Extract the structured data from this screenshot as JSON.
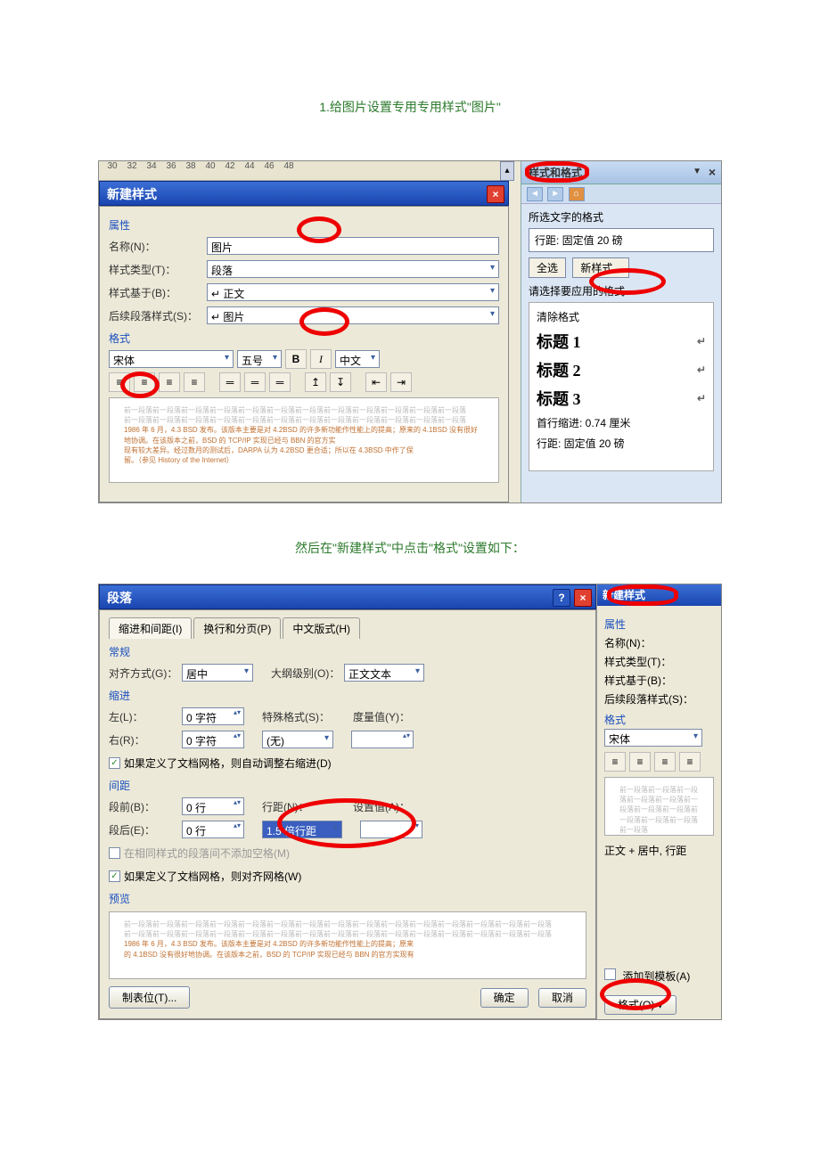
{
  "caption1": "1.给图片设置专用专用样式\"图片\"",
  "caption2": "然后在\"新建样式\"中点击\"格式\"设置如下：",
  "ruler": [
    "30",
    "32",
    "34",
    "36",
    "38",
    "40",
    "42",
    "44",
    "46",
    "48"
  ],
  "dlg1": {
    "title": "新建样式",
    "section_props": "属性",
    "name_lbl": "名称(N)：",
    "name_val": "图片",
    "type_lbl": "样式类型(T)：",
    "type_val": "段落",
    "based_lbl": "样式基于(B)：",
    "based_val": "↵ 正文",
    "follow_lbl": "后续段落样式(S)：",
    "follow_val": "↵ 图片",
    "section_format": "格式",
    "font": "宋体",
    "size": "五号",
    "bold": "B",
    "italic": "I",
    "lang": "中文",
    "preview_grey": "前一段落前一段落前一段落前一段落前一段落前一段落前一段落前一段落前一段落前一段落前一段落前一段落",
    "preview_orange1": "1986 年 6 月，4.3 BSD 发布。该版本主要是对 4.2BSD 的许多新功能作性能上的提高；原来的 4.1BSD 没有很好地协调。在该版本之前，BSD 的 TCP/IP 实现已经与 BBN 的官方实",
    "preview_orange2": "现有较大差异。经过数月的测试后，DARPA 认为 4.2BSD 更合适；所以在 4.3BSD 中作了保",
    "preview_orange3": "留。（参见 History of the Internet）"
  },
  "pane": {
    "title": "样式和格式",
    "selected_lbl": "所选文字的格式",
    "selected_val": "行距: 固定值 20 磅",
    "select_all": "全选",
    "new_style": "新样式...",
    "choose_lbl": "请选择要应用的格式",
    "clear": "清除格式",
    "h1": "标题 1",
    "h2": "标题 2",
    "h3": "标题 3",
    "indent": "首行缩进: 0.74 厘米",
    "line2": "行距: 固定值 20 磅"
  },
  "dlg2": {
    "title": "段落",
    "tab1": "缩进和间距(I)",
    "tab2": "换行和分页(P)",
    "tab3": "中文版式(H)",
    "section_general": "常规",
    "align_lbl": "对齐方式(G)：",
    "align_val": "居中",
    "outline_lbl": "大纲级别(O)：",
    "outline_val": "正文文本",
    "section_indent": "缩进",
    "left_lbl": "左(L)：",
    "left_val": "0 字符",
    "right_lbl": "右(R)：",
    "right_val": "0 字符",
    "special_lbl": "特殊格式(S)：",
    "special_val": "(无)",
    "measure_lbl": "度量值(Y)：",
    "chk1": "如果定义了文档网格，则自动调整右缩进(D)",
    "section_spacing": "间距",
    "before_lbl": "段前(B)：",
    "before_val": "0 行",
    "after_lbl": "段后(E)：",
    "after_val": "0 行",
    "linesp_lbl": "行距(N)：",
    "linesp_val": "1.5 倍行距",
    "setval_lbl": "设置值(A)：",
    "chk2_grey": "在相同样式的段落间不添加空格(M)",
    "chk3": "如果定义了文档网格，则对齐网格(W)",
    "section_preview": "预览",
    "preview_grey": "前一段落前一段落前一段落前一段落前一段落前一段落前一段落前一段落前一段落前一段落前一段落前一段落前一段落前一段落前一段落",
    "preview_orange1": "1986 年 6 月，4.3 BSD 发布。该版本主要是对 4.2BSD 的许多新功能作性能上的提高；原来",
    "preview_orange2": "的 4.1BSD 没有很好地协调。在该版本之前，BSD 的 TCP/IP 实现已经与 BBN 的官方实现有",
    "tabs_btn": "制表位(T)...",
    "ok": "确定",
    "cancel": "取消"
  },
  "frag": {
    "title": "新建样式",
    "attrs": "属性",
    "name": "名称(N)：",
    "type": "样式类型(T)：",
    "based": "样式基于(B)：",
    "follow": "后续段落样式(S)：",
    "fmt": "格式",
    "font": "宋体",
    "summary": "正文 + 居中, 行距",
    "add_tpl": "添加到模板(A)",
    "format_btn": "格式(O) ▾"
  }
}
